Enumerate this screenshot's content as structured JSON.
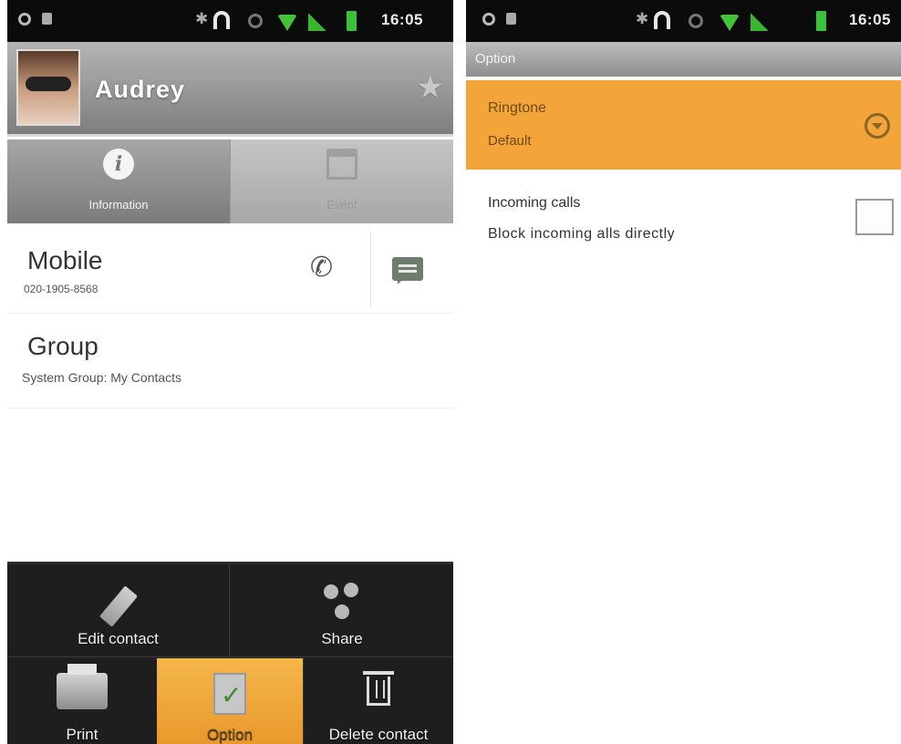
{
  "status_bar": {
    "time": "16:05"
  },
  "contact": {
    "name": "Audrey",
    "tabs": [
      {
        "label": "Information",
        "active": true,
        "icon": "info-icon"
      },
      {
        "label": "Event",
        "active": false,
        "icon": "calendar-icon"
      }
    ],
    "mobile": {
      "label": "Mobile",
      "number": "020-1905-8568"
    },
    "group": {
      "label": "Group",
      "value": "System Group: My Contacts"
    }
  },
  "menu": {
    "edit": "Edit contact",
    "share": "Share",
    "print": "Print",
    "option": "Option",
    "delete": "Delete contact"
  },
  "option_screen": {
    "title": "Option",
    "ringtone": {
      "label": "Ringtone",
      "value": "Default"
    },
    "incoming": {
      "label": "Incoming calls",
      "sub": "Block incoming alls directly",
      "checked": false
    }
  },
  "colors": {
    "accent_orange": "#f3a53a",
    "menu_bg": "#1e1e1e",
    "status_bar_bg": "#0b0b0b"
  }
}
